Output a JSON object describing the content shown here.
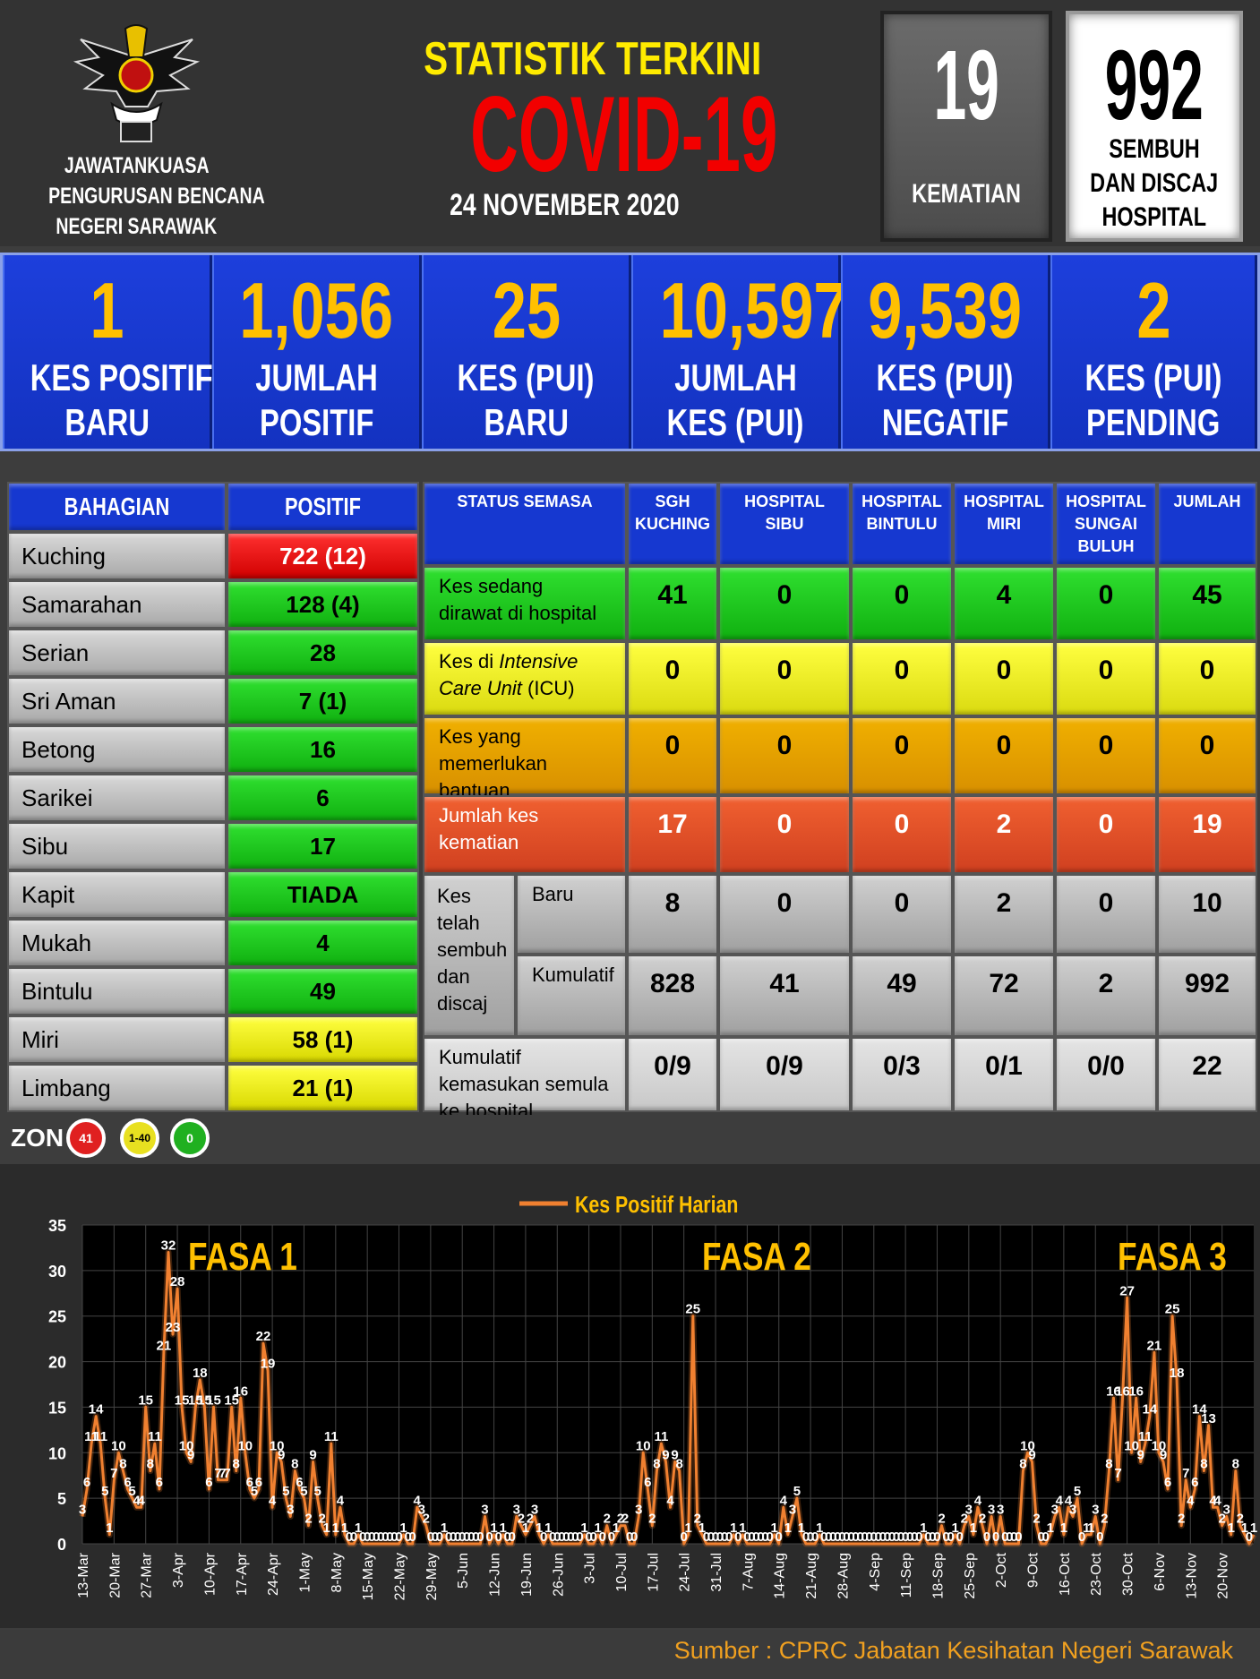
{
  "header": {
    "org_lines": [
      "JAWATANKUASA",
      "PENGURUSAN BENCANA",
      "NEGERI SARAWAK"
    ],
    "title_line1": "STATISTIK TERKINI",
    "title_line2": "COVID-19",
    "date": "24 NOVEMBER 2020",
    "deaths": {
      "value": "19",
      "label": "KEMATIAN"
    },
    "recovered": {
      "value": "992",
      "label_lines": [
        "SEMBUH",
        "DAN DISCAJ",
        "HOSPITAL"
      ]
    }
  },
  "stats": [
    {
      "value": "1",
      "l1": "KES POSITIF",
      "l2": "BARU"
    },
    {
      "value": "1,056",
      "l1": "JUMLAH",
      "l2": "POSITIF"
    },
    {
      "value": "25",
      "l1": "KES (PUI)",
      "l2": "BARU"
    },
    {
      "value": "10,597",
      "l1": "JUMLAH",
      "l2": "KES (PUI)"
    },
    {
      "value": "9,539",
      "l1": "KES (PUI)",
      "l2": "NEGATIF"
    },
    {
      "value": "2",
      "l1": "KES (PUI)",
      "l2": "PENDING"
    }
  ],
  "divisions": {
    "header_name": "BAHAGIAN",
    "header_value": "POSITIF",
    "rows": [
      {
        "name": "Kuching",
        "value": "722 (12)",
        "zone": "red"
      },
      {
        "name": "Samarahan",
        "value": "128 (4)",
        "zone": "green"
      },
      {
        "name": "Serian",
        "value": "28",
        "zone": "green"
      },
      {
        "name": "Sri Aman",
        "value": "7 (1)",
        "zone": "green"
      },
      {
        "name": "Betong",
        "value": "16",
        "zone": "green"
      },
      {
        "name": "Sarikei",
        "value": "6",
        "zone": "green"
      },
      {
        "name": "Sibu",
        "value": "17",
        "zone": "green"
      },
      {
        "name": "Kapit",
        "value": "TIADA",
        "zone": "green"
      },
      {
        "name": "Mukah",
        "value": "4",
        "zone": "green"
      },
      {
        "name": "Bintulu",
        "value": "49",
        "zone": "green"
      },
      {
        "name": "Miri",
        "value": "58 (1)",
        "zone": "yellow"
      },
      {
        "name": "Limbang",
        "value": "21 (1)",
        "zone": "yellow"
      }
    ]
  },
  "status": {
    "headers": [
      "STATUS SEMASA",
      "SGH KUCHING",
      "HOSPITAL SIBU",
      "HOSPITAL BINTULU",
      "HOSPITAL MIRI",
      "HOSPITAL SUNGAI BULUH",
      "JUMLAH"
    ],
    "rows": [
      {
        "label": "Kes sedang dirawat di hospital",
        "values": [
          "41",
          "0",
          "0",
          "4",
          "0",
          "45"
        ]
      },
      {
        "label_pre": "Kes di ",
        "label_italic": "Intensive Care Unit",
        "label_post": " (ICU)",
        "values": [
          "0",
          "0",
          "0",
          "0",
          "0",
          "0"
        ]
      },
      {
        "label": "Kes yang memerlukan bantuan pernafasan",
        "values": [
          "0",
          "0",
          "0",
          "0",
          "0",
          "0"
        ]
      },
      {
        "label": "Jumlah kes kematian",
        "values": [
          "17",
          "0",
          "0",
          "2",
          "0",
          "19"
        ]
      }
    ],
    "recovered_group_label": "Kes telah sembuh dan discaj",
    "recovered_rows": [
      {
        "label": "Baru",
        "values": [
          "8",
          "0",
          "0",
          "2",
          "0",
          "10"
        ]
      },
      {
        "label": "Kumulatif",
        "values": [
          "828",
          "41",
          "49",
          "72",
          "2",
          "992"
        ]
      }
    ],
    "readmission": {
      "label": "Kumulatif kemasukan semula ke hospital",
      "values": [
        "0/9",
        "0/9",
        "0/3",
        "0/1",
        "0/0",
        "22"
      ]
    }
  },
  "zones": {
    "label": "ZON",
    "items": [
      {
        "text": "41",
        "color": "#e02020"
      },
      {
        "text": "1-40",
        "color": "#e8e020"
      },
      {
        "text": "0",
        "color": "#20b020"
      }
    ]
  },
  "chart_data": {
    "type": "line",
    "title": "",
    "legend": "Kes Positif Harian",
    "legend_position": "top-center",
    "ylim": [
      0,
      35
    ],
    "yticks": [
      0,
      5,
      10,
      15,
      20,
      25,
      30,
      35
    ],
    "grid": true,
    "line_color": "#f08030",
    "x_ticks": [
      "13-Mar",
      "20-Mar",
      "27-Mar",
      "3-Apr",
      "10-Apr",
      "17-Apr",
      "24-Apr",
      "1-May",
      "8-May",
      "15-May",
      "22-May",
      "29-May",
      "5-Jun",
      "12-Jun",
      "19-Jun",
      "26-Jun",
      "3-Jul",
      "10-Jul",
      "17-Jul",
      "24-Jul",
      "31-Jul",
      "7-Aug",
      "14-Aug",
      "21-Aug",
      "28-Aug",
      "4-Sep",
      "11-Sep",
      "18-Sep",
      "25-Sep",
      "2-Oct",
      "9-Oct",
      "16-Oct",
      "23-Oct",
      "30-Oct",
      "6-Nov",
      "13-Nov",
      "20-Nov"
    ],
    "phases": [
      "FASA 1",
      "FASA 2",
      "FASA 3"
    ],
    "values": [
      3,
      6,
      11,
      14,
      11,
      5,
      1,
      7,
      10,
      8,
      6,
      5,
      4,
      4,
      15,
      8,
      11,
      6,
      21,
      32,
      23,
      28,
      15,
      10,
      9,
      15,
      18,
      15,
      6,
      15,
      7,
      7,
      7,
      15,
      8,
      16,
      10,
      6,
      5,
      6,
      22,
      19,
      4,
      10,
      9,
      5,
      3,
      8,
      6,
      5,
      2,
      9,
      5,
      2,
      1,
      11,
      1,
      4,
      1,
      0,
      0,
      1,
      0,
      0,
      0,
      0,
      0,
      0,
      0,
      0,
      0,
      1,
      0,
      0,
      4,
      3,
      2,
      0,
      0,
      0,
      1,
      0,
      0,
      0,
      0,
      0,
      0,
      0,
      0,
      3,
      0,
      1,
      0,
      1,
      0,
      0,
      3,
      2,
      1,
      2,
      3,
      1,
      0,
      1,
      0,
      0,
      0,
      0,
      0,
      0,
      0,
      1,
      0,
      0,
      1,
      0,
      2,
      0,
      1,
      2,
      2,
      0,
      0,
      3,
      10,
      6,
      2,
      8,
      11,
      9,
      4,
      9,
      8,
      0,
      1,
      25,
      2,
      1,
      0,
      0,
      0,
      0,
      0,
      0,
      1,
      0,
      1,
      0,
      0,
      0,
      0,
      0,
      0,
      1,
      0,
      4,
      1,
      3,
      5,
      1,
      0,
      0,
      0,
      1,
      0,
      0,
      0,
      0,
      0,
      0,
      0,
      0,
      0,
      0,
      0,
      0,
      0,
      0,
      0,
      0,
      0,
      0,
      0,
      0,
      0,
      0,
      1,
      0,
      0,
      0,
      2,
      0,
      0,
      1,
      0,
      2,
      3,
      1,
      4,
      2,
      0,
      3,
      0,
      3,
      0,
      0,
      0,
      0,
      8,
      10,
      9,
      2,
      0,
      0,
      1,
      3,
      4,
      1,
      4,
      3,
      5,
      0,
      1,
      1,
      3,
      0,
      2,
      8,
      16,
      7,
      16,
      27,
      10,
      16,
      9,
      11,
      14,
      21,
      10,
      9,
      6,
      25,
      18,
      2,
      7,
      4,
      6,
      14,
      8,
      13,
      4,
      4,
      2,
      3,
      1,
      8,
      2,
      1,
      0,
      1
    ]
  },
  "source": "Sumber : CPRC Jabatan Kesihatan Negeri Sarawak"
}
